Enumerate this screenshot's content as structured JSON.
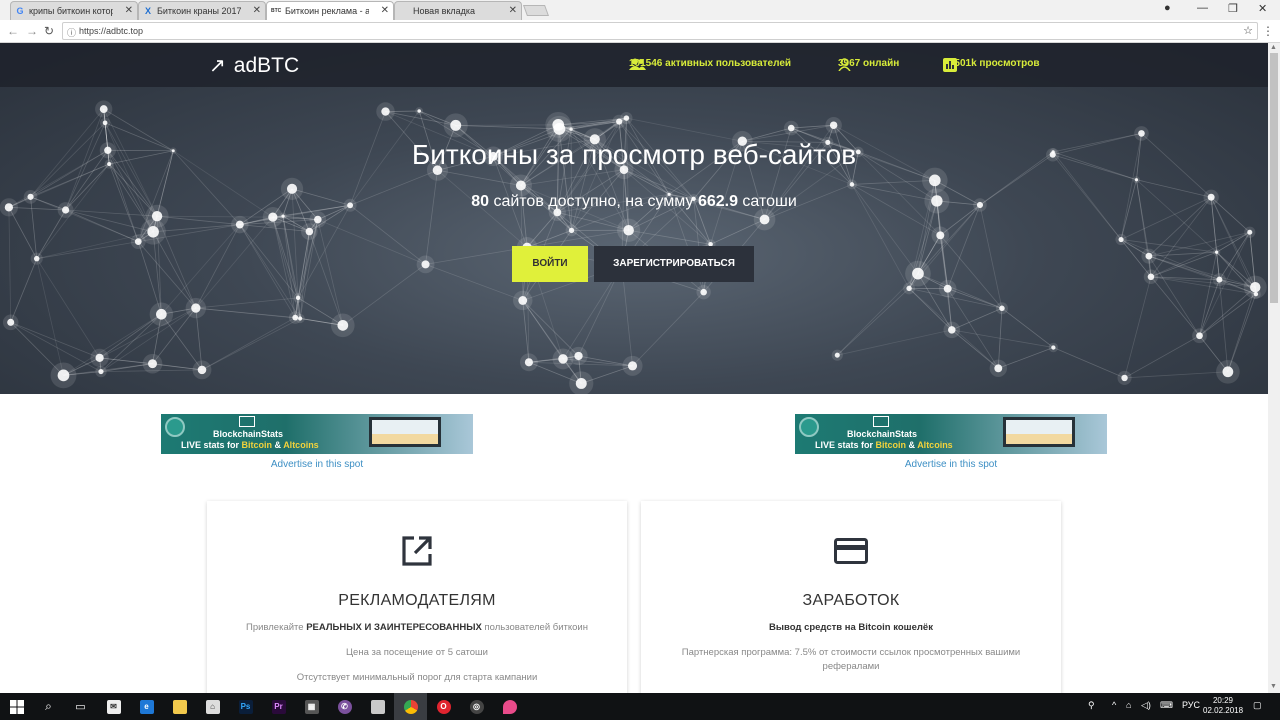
{
  "browser": {
    "tabs": [
      {
        "label": "крипы биткоин которые",
        "favicon": "G"
      },
      {
        "label": "Биткоин краны 2017 ко",
        "favicon": "X"
      },
      {
        "label": "Биткоин реклама - adbtc",
        "favicon": "BTC"
      },
      {
        "label": "Новая вкладка",
        "favicon": ""
      }
    ],
    "url": "https://adbtc.top"
  },
  "site": {
    "logo": "adBTC",
    "stats": {
      "users": "101546 активных пользователей",
      "online": "3967 онлайн",
      "views": "~1501k просмотров"
    },
    "hero": {
      "title": "Биткоины за просмотр веб-сайтов",
      "sites_count": "80",
      "sub_mid": " сайтов доступно, на сумму ",
      "amount": "662.9",
      "sub_end": " сатоши"
    },
    "buttons": {
      "login": "ВОЙТИ",
      "register": "ЗАРЕГИСТРИРОВАТЬСЯ"
    },
    "banners": [
      {
        "name": "BlockchainStats",
        "live_prefix": "LIVE stats for ",
        "live_b1": "Bitcoin",
        "live_amp": " & ",
        "live_b2": "Altcoins",
        "advertise": "Advertise in this spot"
      },
      {
        "name": "BlockchainStats",
        "live_prefix": "LIVE stats for ",
        "live_b1": "Bitcoin",
        "live_amp": " & ",
        "live_b2": "Altcoins",
        "advertise": "Advertise in this spot"
      }
    ],
    "cards": {
      "advertisers": {
        "title": "РЕКЛАМОДАТЕЛЯМ",
        "line1_pre": "Привлекайте ",
        "line1_bold": "РЕАЛЬНЫХ И ЗАИНТЕРЕСОВАННЫХ",
        "line1_post": " пользователей биткоин",
        "line2": "Цена за посещение от 5 сатоши",
        "line3": "Отсутствует минимальный порог для старта кампании"
      },
      "earnings": {
        "title": "ЗАРАБОТОК",
        "line1": "Вывод средств на Bitcoin кошелёк",
        "line2": "Партнерская программа: 7.5% от стоимости ссылок просмотренных вашими рефералами"
      }
    }
  },
  "taskbar": {
    "lang": "РУС",
    "time": "20:29",
    "date": "02.02.2018"
  },
  "colors": {
    "accent": "#e0f03a",
    "dark": "#2c313b",
    "link": "#3d8fc4"
  }
}
